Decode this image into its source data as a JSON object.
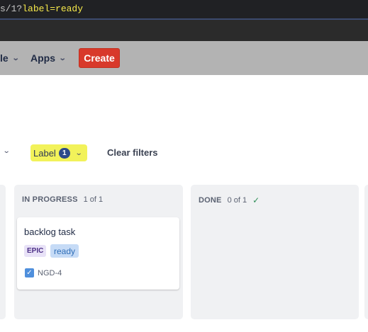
{
  "browser": {
    "url_path": "s/1?",
    "url_query": "label=ready"
  },
  "header": {
    "nav_items": [
      {
        "label": "le"
      },
      {
        "label": "Apps"
      }
    ],
    "create_label": "Create"
  },
  "filters": {
    "label_filter": "Label",
    "label_count": "1",
    "clear_label": "Clear filters"
  },
  "columns": [
    {
      "title": "IN PROGRESS",
      "count": "1 of 1"
    },
    {
      "title": "DONE",
      "count": "0 of 1"
    }
  ],
  "card": {
    "title": "backlog task",
    "epic_tag": "EPIC",
    "label_tag": "ready",
    "issue_key": "NGD-4"
  },
  "icons": {
    "chevron": "chevron-down-icon",
    "done_check": "check-icon",
    "issue_type": "checkbox-icon"
  },
  "colors": {
    "create_button": "#d8392b",
    "highlight": "#f2f25a",
    "badge": "#2d4a8a"
  }
}
